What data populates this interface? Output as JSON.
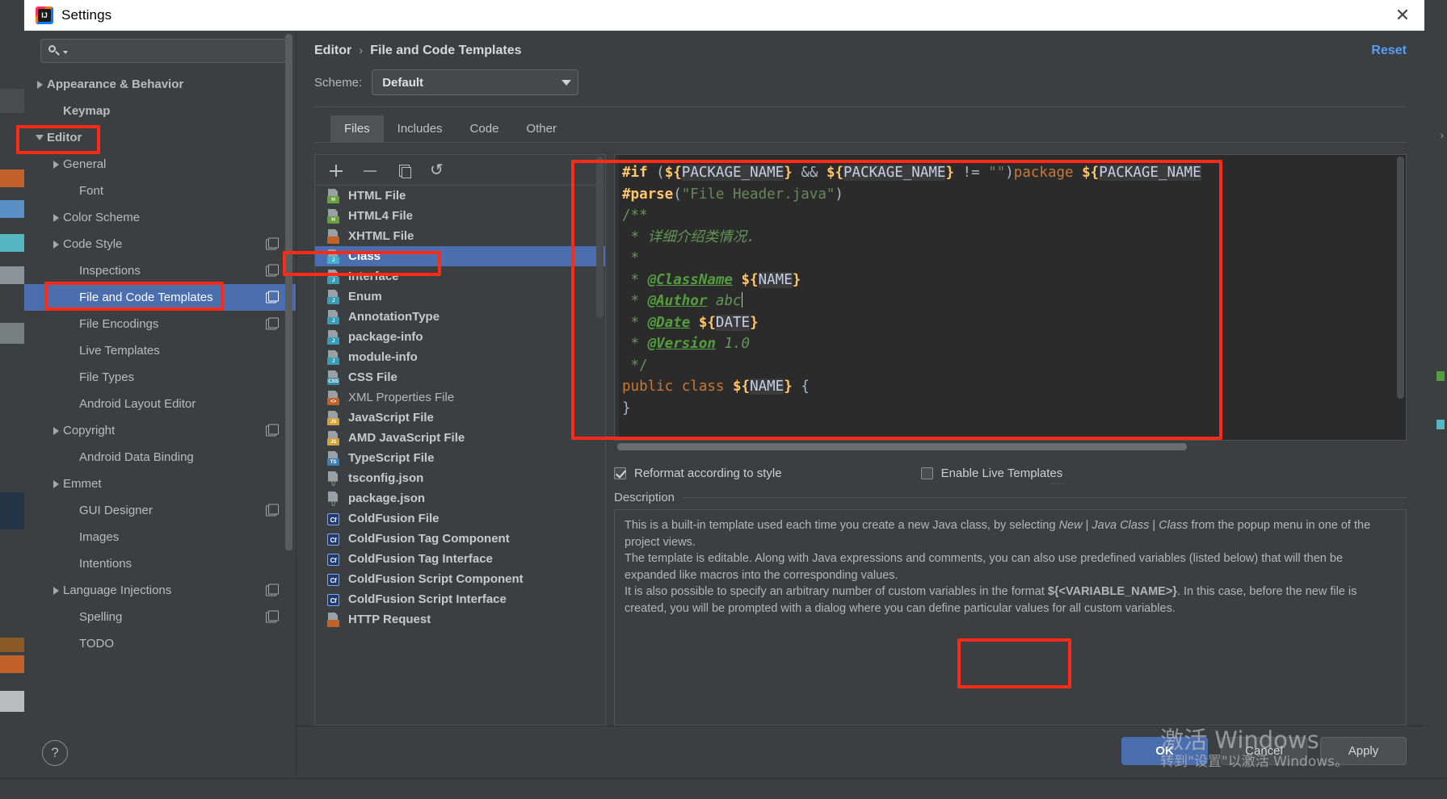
{
  "window": {
    "title": "Settings",
    "logo_text": "IJ",
    "close_icon": "✕"
  },
  "sidebar": {
    "search": {
      "placeholder": "",
      "value": "",
      "icon": "search-icon"
    },
    "items": [
      {
        "label": "Appearance & Behavior",
        "arrow": "right",
        "indent": 0,
        "bold": true,
        "selected": false,
        "copy": false
      },
      {
        "label": "Keymap",
        "arrow": "none",
        "indent": 1,
        "bold": true,
        "selected": false,
        "copy": false
      },
      {
        "label": "Editor",
        "arrow": "down",
        "indent": 0,
        "bold": true,
        "selected": false,
        "copy": false
      },
      {
        "label": "General",
        "arrow": "right",
        "indent": 1,
        "bold": false,
        "selected": false,
        "copy": false
      },
      {
        "label": "Font",
        "arrow": "none",
        "indent": 2,
        "bold": false,
        "selected": false,
        "copy": false
      },
      {
        "label": "Color Scheme",
        "arrow": "right",
        "indent": 1,
        "bold": false,
        "selected": false,
        "copy": false
      },
      {
        "label": "Code Style",
        "arrow": "right",
        "indent": 1,
        "bold": false,
        "selected": false,
        "copy": true
      },
      {
        "label": "Inspections",
        "arrow": "none",
        "indent": 2,
        "bold": false,
        "selected": false,
        "copy": true
      },
      {
        "label": "File and Code Templates",
        "arrow": "none",
        "indent": 2,
        "bold": false,
        "selected": true,
        "copy": true
      },
      {
        "label": "File Encodings",
        "arrow": "none",
        "indent": 2,
        "bold": false,
        "selected": false,
        "copy": true
      },
      {
        "label": "Live Templates",
        "arrow": "none",
        "indent": 2,
        "bold": false,
        "selected": false,
        "copy": false
      },
      {
        "label": "File Types",
        "arrow": "none",
        "indent": 2,
        "bold": false,
        "selected": false,
        "copy": false
      },
      {
        "label": "Android Layout Editor",
        "arrow": "none",
        "indent": 2,
        "bold": false,
        "selected": false,
        "copy": false
      },
      {
        "label": "Copyright",
        "arrow": "right",
        "indent": 1,
        "bold": false,
        "selected": false,
        "copy": true
      },
      {
        "label": "Android Data Binding",
        "arrow": "none",
        "indent": 2,
        "bold": false,
        "selected": false,
        "copy": false
      },
      {
        "label": "Emmet",
        "arrow": "right",
        "indent": 1,
        "bold": false,
        "selected": false,
        "copy": false
      },
      {
        "label": "GUI Designer",
        "arrow": "none",
        "indent": 2,
        "bold": false,
        "selected": false,
        "copy": true
      },
      {
        "label": "Images",
        "arrow": "none",
        "indent": 2,
        "bold": false,
        "selected": false,
        "copy": false
      },
      {
        "label": "Intentions",
        "arrow": "none",
        "indent": 2,
        "bold": false,
        "selected": false,
        "copy": false
      },
      {
        "label": "Language Injections",
        "arrow": "right",
        "indent": 1,
        "bold": false,
        "selected": false,
        "copy": true
      },
      {
        "label": "Spelling",
        "arrow": "none",
        "indent": 2,
        "bold": false,
        "selected": false,
        "copy": true
      },
      {
        "label": "TODO",
        "arrow": "none",
        "indent": 2,
        "bold": false,
        "selected": false,
        "copy": false
      }
    ],
    "help_label": "?"
  },
  "breadcrumb": {
    "parent": "Editor",
    "separator": "›",
    "current": "File and Code Templates"
  },
  "reset_label": "Reset",
  "scheme": {
    "label": "Scheme:",
    "value": "Default"
  },
  "tabs": [
    {
      "label": "Files",
      "active": true
    },
    {
      "label": "Includes",
      "active": false
    },
    {
      "label": "Code",
      "active": false
    },
    {
      "label": "Other",
      "active": false
    }
  ],
  "templates_toolbar": [
    {
      "name": "add-template-button",
      "icon": "plus-icon"
    },
    {
      "name": "remove-template-button",
      "icon": "minus-icon"
    },
    {
      "name": "copy-template-button",
      "icon": "copy-icon"
    },
    {
      "name": "reset-template-button",
      "icon": "undo-icon",
      "glyph": "↺"
    }
  ],
  "templates": [
    {
      "label": "HTML File",
      "badge": "H",
      "badge_color": "#6a9f3f",
      "kind": "file",
      "bold": true,
      "selected": false
    },
    {
      "label": "HTML4 File",
      "badge": "H",
      "badge_color": "#6a9f3f",
      "kind": "file",
      "bold": true,
      "selected": false
    },
    {
      "label": "XHTML File",
      "badge": "",
      "badge_color": "#c2622a",
      "kind": "file",
      "bold": true,
      "selected": false
    },
    {
      "label": "Class",
      "badge": "J",
      "badge_color": "#43b0cf",
      "kind": "file",
      "bold": true,
      "selected": true
    },
    {
      "label": "Interface",
      "badge": "J",
      "badge_color": "#3a9cb5",
      "kind": "file",
      "bold": true,
      "selected": false
    },
    {
      "label": "Enum",
      "badge": "J",
      "badge_color": "#3a9cb5",
      "kind": "file",
      "bold": true,
      "selected": false
    },
    {
      "label": "AnnotationType",
      "badge": "J",
      "badge_color": "#3a9cb5",
      "kind": "file",
      "bold": true,
      "selected": false
    },
    {
      "label": "package-info",
      "badge": "J",
      "badge_color": "#3a9cb5",
      "kind": "file",
      "bold": true,
      "selected": false
    },
    {
      "label": "module-info",
      "badge": "J",
      "badge_color": "#3a9cb5",
      "kind": "file",
      "bold": true,
      "selected": false
    },
    {
      "label": "CSS File",
      "badge": "CSS",
      "badge_color": "#3a8fa8",
      "kind": "file",
      "bold": true,
      "selected": false
    },
    {
      "label": "XML Properties File",
      "badge": "<>",
      "badge_color": "#c2622a",
      "kind": "file",
      "bold": false,
      "selected": false
    },
    {
      "label": "JavaScript File",
      "badge": "JS",
      "badge_color": "#d1a23a",
      "kind": "file",
      "bold": true,
      "selected": false
    },
    {
      "label": "AMD JavaScript File",
      "badge": "JS",
      "badge_color": "#d1a23a",
      "kind": "file",
      "bold": true,
      "selected": false
    },
    {
      "label": "TypeScript File",
      "badge": "TS",
      "badge_color": "#3a7fb5",
      "kind": "file",
      "bold": true,
      "selected": false
    },
    {
      "label": "tsconfig.json",
      "badge": "{}",
      "badge_color": "",
      "kind": "json",
      "bold": true,
      "selected": false
    },
    {
      "label": "package.json",
      "badge": "{}",
      "badge_color": "",
      "kind": "json",
      "bold": true,
      "selected": false
    },
    {
      "label": "ColdFusion File",
      "badge": "Cf",
      "badge_color": "#1f3a6e",
      "kind": "cf",
      "bold": true,
      "selected": false
    },
    {
      "label": "ColdFusion Tag Component",
      "badge": "Cf",
      "badge_color": "#1f3a6e",
      "kind": "cf",
      "bold": true,
      "selected": false
    },
    {
      "label": "ColdFusion Tag Interface",
      "badge": "Cf",
      "badge_color": "#1f3a6e",
      "kind": "cf",
      "bold": true,
      "selected": false
    },
    {
      "label": "ColdFusion Script Component",
      "badge": "Cf",
      "badge_color": "#1f3a6e",
      "kind": "cf",
      "bold": true,
      "selected": false
    },
    {
      "label": "ColdFusion Script Interface",
      "badge": "Cf",
      "badge_color": "#1f3a6e",
      "kind": "cf",
      "bold": true,
      "selected": false
    },
    {
      "label": "HTTP Request",
      "badge": "",
      "badge_color": "#c2622a",
      "kind": "file",
      "bold": true,
      "selected": false
    }
  ],
  "editor": {
    "author_value": "abc",
    "version_value": "1.0",
    "lines": [
      "#if (${PACKAGE_NAME} && ${PACKAGE_NAME} != \"\")package ${PACKAGE_NAME};#end",
      "#parse(\"File Header.java\")",
      "/**",
      " * 详细介绍类情况.",
      " *",
      " * @ClassName ${NAME}",
      " * @Author abc",
      " * @Date ${DATE}",
      " * @Version 1.0",
      " */",
      "public class ${NAME} {",
      "}"
    ]
  },
  "options": {
    "reformat": {
      "label": "Reformat according to style",
      "checked": true
    },
    "live_templates": {
      "label": "Enable Live Templates",
      "checked": false
    }
  },
  "description": {
    "title": "Description",
    "p1_a": "This is a built-in template used each time you create a new Java class, by selecting ",
    "p1_i1": "New",
    "p1_b": " | ",
    "p1_i2": "Java Class",
    "p1_c": " | ",
    "p1_i3": "Class",
    "p1_d": " from the popup menu in one of the project views.",
    "p2": "The template is editable. Along with Java expressions and comments, you can also use predefined variables (listed below) that will then be expanded like macros into the corresponding values.",
    "p3_a": "It is also possible to specify an arbitrary number of custom variables in the format ",
    "p3_var": "${<VARIABLE_NAME>}",
    "p3_b": ". In this case, before the new file is created, you will be prompted with a dialog where you can define particular values for all custom variables."
  },
  "footer": {
    "ok": "OK",
    "cancel": "Cancel",
    "apply": "Apply"
  },
  "watermark": {
    "line1": "激活 Windows",
    "line2": "转到\"设置\"以激活 Windows。"
  }
}
